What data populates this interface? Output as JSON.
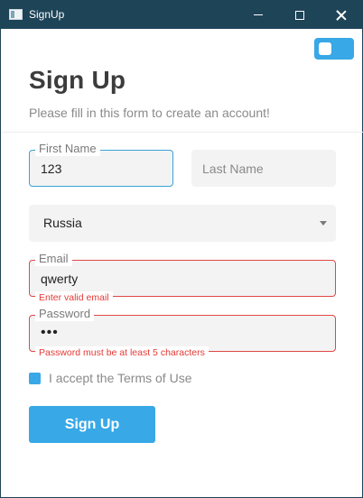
{
  "window": {
    "title": "SignUp",
    "icon": "app-window-icon"
  },
  "colors": {
    "accent": "#38a8e6",
    "titlebar": "#1e4458",
    "error": "#e53935"
  },
  "theme_toggle": {
    "state": "on"
  },
  "header": {
    "title": "Sign Up",
    "subtitle": "Please fill in this form to create an account!"
  },
  "form": {
    "first_name": {
      "label": "First Name",
      "value": "123"
    },
    "last_name": {
      "placeholder": "Last Name",
      "value": ""
    },
    "country": {
      "selected": "Russia"
    },
    "email": {
      "label": "Email",
      "value": "qwerty",
      "error": "Enter valid email"
    },
    "password": {
      "label": "Password",
      "value": "•••",
      "error": "Password must be at least 5 characters"
    },
    "terms": {
      "label": "I accept the Terms of Use",
      "checked": true
    },
    "submit_label": "Sign Up"
  }
}
